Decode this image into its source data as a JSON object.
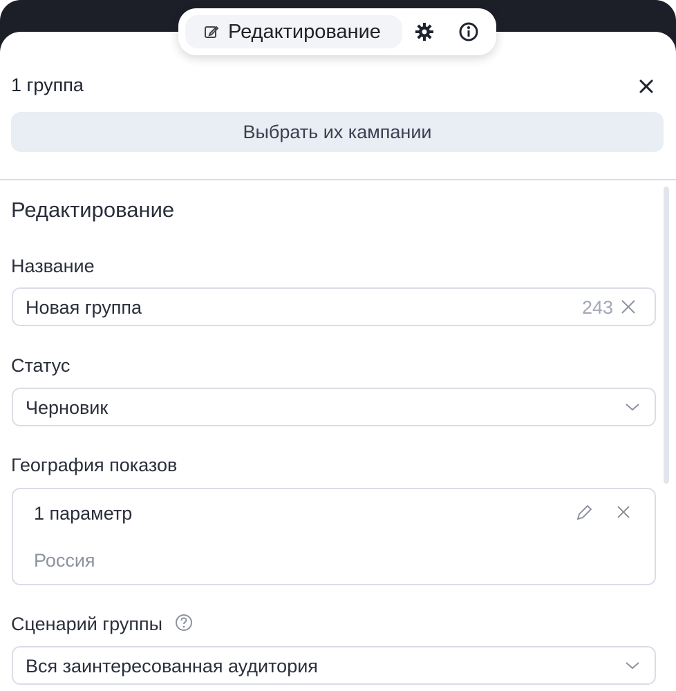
{
  "toolbar": {
    "mode_label": "Редактирование",
    "icons": [
      "edit-icon",
      "gear-icon",
      "info-icon"
    ]
  },
  "header": {
    "title": "1 группа"
  },
  "actions": {
    "choose_campaigns_label": "Выбрать их кампании"
  },
  "section": {
    "title": "Редактирование"
  },
  "fields": {
    "name": {
      "label": "Название",
      "value": "Новая группа",
      "counter": "243"
    },
    "status": {
      "label": "Статус",
      "value": "Черновик"
    },
    "geo": {
      "label": "География показов",
      "param": "1 параметр",
      "country": "Россия"
    },
    "scenario": {
      "label": "Сценарий группы",
      "value": "Вся заинтересованная аудитория"
    }
  },
  "colors": {
    "dark": "#1c1f27",
    "button_bg": "#e9edf4",
    "border": "#dadde5",
    "muted_text": "#8d92a0"
  }
}
